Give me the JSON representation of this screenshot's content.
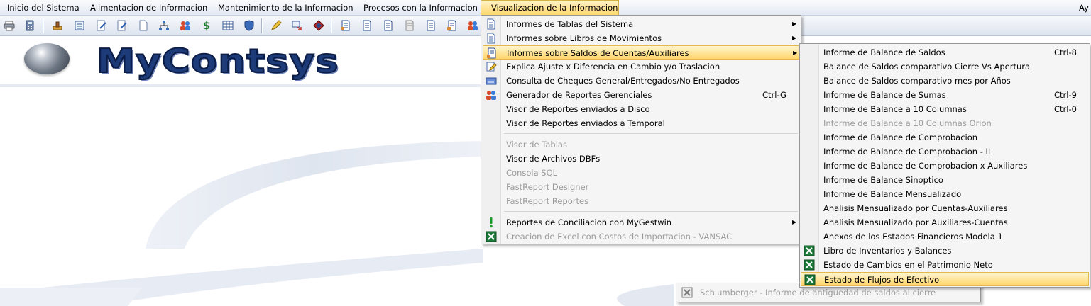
{
  "menubar": {
    "items": [
      "Inicio del Sistema",
      "Alimentacion de Informacion",
      "Mantenimiento de la Informacion",
      "Procesos con la Informacion",
      "Visualizacion de la Informacion"
    ],
    "right": "Ay"
  },
  "toolbar": {
    "icons": [
      "print-icon",
      "calculator-icon",
      "stamp-icon",
      "list-icon",
      "edit-icon",
      "edit-icon",
      "document-icon",
      "tree-icon",
      "users-icon",
      "dollar-icon",
      "table-icon",
      "shield-icon",
      "pen-icon",
      "transfer-icon",
      "diamond-icon",
      "report-icon",
      "report-icon",
      "report-icon",
      "report-icon",
      "report-icon",
      "report-icon",
      "users-icon"
    ]
  },
  "logo": {
    "text": "MyContsys"
  },
  "menu1": {
    "items": [
      {
        "label": "Informes de Tablas del Sistema",
        "accel": "",
        "submenu": true,
        "disabled": false,
        "icon": "document-icon"
      },
      {
        "label": "Informes sobre Libros de Movimientos",
        "accel": "",
        "submenu": true,
        "disabled": false,
        "icon": "document-icon"
      },
      {
        "label": "Informes sobre Saldos de Cuentas/Auxiliares",
        "accel": "",
        "submenu": true,
        "disabled": false,
        "icon": "report-icon"
      },
      {
        "label": "Explica Ajuste x Diferencia en Cambio y/o Traslacion",
        "accel": "",
        "submenu": false,
        "disabled": false,
        "icon": "pen-icon"
      },
      {
        "label": "Consulta de Cheques General/Entregados/No Entregados",
        "accel": "",
        "submenu": false,
        "disabled": false,
        "icon": "cheque-icon"
      },
      {
        "label": "Generador de Reportes Gerenciales",
        "accel": "Ctrl-G",
        "submenu": false,
        "disabled": false,
        "icon": "users-icon"
      },
      {
        "label": "Visor de Reportes enviados a Disco",
        "accel": "",
        "submenu": false,
        "disabled": false,
        "icon": ""
      },
      {
        "label": "Visor de Reportes enviados a Temporal",
        "accel": "",
        "submenu": false,
        "disabled": false,
        "icon": ""
      },
      {
        "label": "Visor de Tablas",
        "accel": "",
        "submenu": false,
        "disabled": true,
        "icon": ""
      },
      {
        "label": "Visor de Archivos DBFs",
        "accel": "",
        "submenu": false,
        "disabled": false,
        "icon": ""
      },
      {
        "label": "Consola SQL",
        "accel": "",
        "submenu": false,
        "disabled": true,
        "icon": ""
      },
      {
        "label": "FastReport Designer",
        "accel": "",
        "submenu": false,
        "disabled": true,
        "icon": ""
      },
      {
        "label": "FastReport Reportes",
        "accel": "",
        "submenu": false,
        "disabled": true,
        "icon": ""
      },
      {
        "label": "Reportes de Conciliacion con MyGestwin",
        "accel": "",
        "submenu": true,
        "disabled": false,
        "icon": "exclamation-icon"
      },
      {
        "label": "Creacion de Excel con Costos de Importacion - VANSAC",
        "accel": "",
        "submenu": false,
        "disabled": true,
        "icon": "excel-icon"
      }
    ]
  },
  "menu2": {
    "items": [
      {
        "label": "Informe de Balance de Saldos",
        "accel": "Ctrl-8",
        "disabled": false,
        "icon": ""
      },
      {
        "label": "Balance de Saldos comparativo Cierre Vs Apertura",
        "accel": "",
        "disabled": false,
        "icon": ""
      },
      {
        "label": "Balance de Saldos comparativo mes por Años",
        "accel": "",
        "disabled": false,
        "icon": ""
      },
      {
        "label": "Informe de Balance de Sumas",
        "accel": "Ctrl-9",
        "disabled": false,
        "icon": ""
      },
      {
        "label": "Informe de Balance a 10 Columnas",
        "accel": "Ctrl-0",
        "disabled": false,
        "icon": ""
      },
      {
        "label": "Informe de Balance a 10 Columnas Orion",
        "accel": "",
        "disabled": true,
        "icon": ""
      },
      {
        "label": "Informe de Balance de Comprobacion",
        "accel": "",
        "disabled": false,
        "icon": ""
      },
      {
        "label": "Informe de Balance de Comprobacion - II",
        "accel": "",
        "disabled": false,
        "icon": ""
      },
      {
        "label": "Informe de Balance de Comprobacion x Auxiliares",
        "accel": "",
        "disabled": false,
        "icon": ""
      },
      {
        "label": "Informe de Balance Sinoptico",
        "accel": "",
        "disabled": false,
        "icon": ""
      },
      {
        "label": "Informe de Balance Mensualizado",
        "accel": "",
        "disabled": false,
        "icon": ""
      },
      {
        "label": "Analisis Mensualizado por Cuentas-Auxiliares",
        "accel": "",
        "disabled": false,
        "icon": ""
      },
      {
        "label": "Analisis Mensualizado por Auxiliares-Cuentas",
        "accel": "",
        "disabled": false,
        "icon": ""
      },
      {
        "label": "Anexos de los Estados Financieros Modela 1",
        "accel": "",
        "disabled": false,
        "icon": ""
      },
      {
        "label": "Libro de Inventarios y Balances",
        "accel": "",
        "disabled": false,
        "icon": "excel-icon"
      },
      {
        "label": "Estado de Cambios en el Patrimonio Neto",
        "accel": "",
        "disabled": false,
        "icon": "excel-icon"
      },
      {
        "label": "Estado de Flujos de Efectivo",
        "accel": "",
        "disabled": false,
        "icon": "excel-icon"
      }
    ]
  },
  "menu3": {
    "label": "Schlumberger - Informe de antiguedad de saldos al cierre",
    "icon": "excel-icon"
  }
}
